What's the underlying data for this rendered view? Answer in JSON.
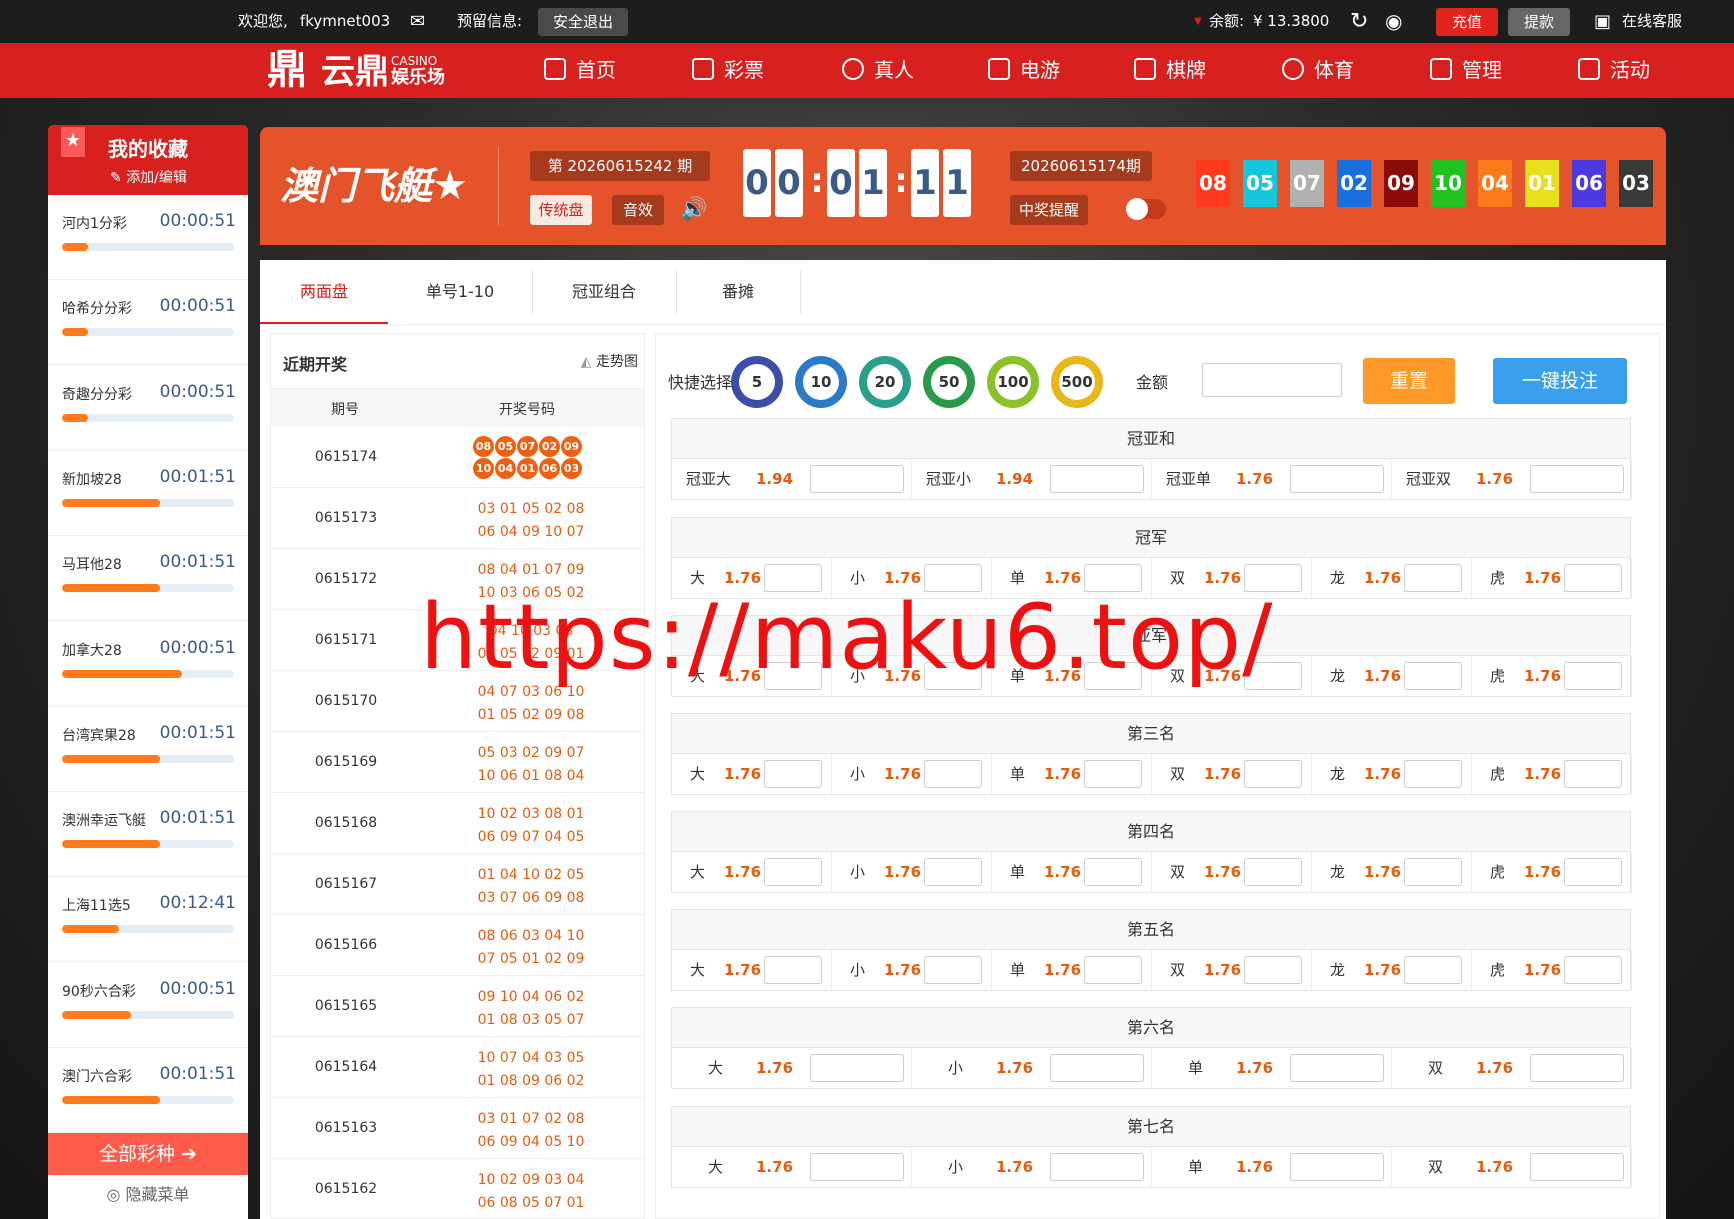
{
  "topbar": {
    "welcome": "欢迎您,",
    "username": "fkymnet003",
    "reserved": "预留信息:",
    "logout": "安全退出",
    "balance_label": "余额:",
    "balance_value": "¥ 13.3800",
    "recharge": "充值",
    "withdraw": "提款",
    "service": "在线客服"
  },
  "logo": {
    "mark": "鼎",
    "name": "云鼎",
    "casino": "CASINO",
    "sub": "娱乐场"
  },
  "nav": [
    "首页",
    "彩票",
    "真人",
    "电游",
    "棋牌",
    "体育",
    "管理",
    "活动"
  ],
  "sidebar": {
    "title": "我的收藏",
    "edit": "添加/编辑",
    "items": [
      {
        "name": "河内1分彩",
        "time": "00:00:51",
        "progress": 0.15
      },
      {
        "name": "哈希分分彩",
        "time": "00:00:51",
        "progress": 0.15
      },
      {
        "name": "奇趣分分彩",
        "time": "00:00:51",
        "progress": 0.15
      },
      {
        "name": "新加坡28",
        "time": "00:01:51",
        "progress": 0.57
      },
      {
        "name": "马耳他28",
        "time": "00:01:51",
        "progress": 0.57
      },
      {
        "name": "加拿大28",
        "time": "00:00:51",
        "progress": 0.7
      },
      {
        "name": "台湾宾果28",
        "time": "00:01:51",
        "progress": 0.57
      },
      {
        "name": "澳洲幸运飞艇",
        "time": "00:01:51",
        "progress": 0.57
      },
      {
        "name": "上海11选5",
        "time": "00:12:41",
        "progress": 0.33
      },
      {
        "name": "90秒六合彩",
        "time": "00:00:51",
        "progress": 0.4
      },
      {
        "name": "澳门六合彩",
        "time": "00:01:51",
        "progress": 0.57
      }
    ],
    "all_games": "全部彩种",
    "hide_menu": "隐藏菜单"
  },
  "game": {
    "title": "澳门飞艇",
    "issue": "第 20260615242 期",
    "traditional": "传统盘",
    "sound": "音效",
    "countdown": [
      "0",
      "0",
      ":",
      "0",
      "1",
      ":",
      "1",
      "1"
    ],
    "last_issue": "20260615174期",
    "win_alert": "中奖提醒",
    "balls": [
      {
        "n": "08",
        "c": "#ff3b1f"
      },
      {
        "n": "05",
        "c": "#15c6dd"
      },
      {
        "n": "07",
        "c": "#b0b0b0"
      },
      {
        "n": "02",
        "c": "#1a6fe0"
      },
      {
        "n": "09",
        "c": "#8b0a0a"
      },
      {
        "n": "10",
        "c": "#22c222"
      },
      {
        "n": "04",
        "c": "#ff7a1a"
      },
      {
        "n": "01",
        "c": "#e8e01a"
      },
      {
        "n": "06",
        "c": "#4a3ae0"
      },
      {
        "n": "03",
        "c": "#3a3a3a"
      }
    ]
  },
  "tabs": [
    "两面盘",
    "单号1-10",
    "冠亚组合",
    "番摊"
  ],
  "recent": {
    "title": "近期开奖",
    "trend": "走势图",
    "col_issue": "期号",
    "col_nums": "开奖号码",
    "first": {
      "issue": "0615174",
      "balls": [
        "08",
        "05",
        "07",
        "02",
        "09",
        "10",
        "04",
        "01",
        "06",
        "03"
      ]
    },
    "rows": [
      {
        "issue": "0615173",
        "a": "03 01 05 02 08",
        "b": "06 04 09 10 07"
      },
      {
        "issue": "0615172",
        "a": "08 04 01 07 09",
        "b": "10 03 06 05 02"
      },
      {
        "issue": "0615171",
        "a": "04 10 03 08",
        "b": "07 05 02 09 01"
      },
      {
        "issue": "0615170",
        "a": "04 07 03 06 10",
        "b": "01 05 02 09 08"
      },
      {
        "issue": "0615169",
        "a": "05 03 02 09 07",
        "b": "10 06 01 08 04"
      },
      {
        "issue": "0615168",
        "a": "10 02 03 08 01",
        "b": "06 09 07 04 05"
      },
      {
        "issue": "0615167",
        "a": "01 04 10 02 05",
        "b": "03 07 06 09 08"
      },
      {
        "issue": "0615166",
        "a": "08 06 03 04 10",
        "b": "07 05 01 02 09"
      },
      {
        "issue": "0615165",
        "a": "09 10 04 06 02",
        "b": "01 08 03 05 07"
      },
      {
        "issue": "0615164",
        "a": "10 07 04 03 05",
        "b": "01 08 09 06 02"
      },
      {
        "issue": "0615163",
        "a": "03 01 07 02 08",
        "b": "06 09 04 05 10"
      },
      {
        "issue": "0615162",
        "a": "10 02 09 03 04",
        "b": "06 08 05 07 01"
      }
    ]
  },
  "betting": {
    "quick": "快捷选择",
    "chips": [
      "5",
      "10",
      "20",
      "50",
      "100",
      "500"
    ],
    "amount": "金额",
    "reset": "重置",
    "bet": "一键投注",
    "sections": [
      {
        "title": "冠亚和",
        "cells": [
          [
            "冠亚大",
            "1.94"
          ],
          [
            "冠亚小",
            "1.94"
          ],
          [
            "冠亚单",
            "1.76"
          ],
          [
            "冠亚双",
            "1.76"
          ]
        ]
      },
      {
        "title": "冠军",
        "cells": [
          [
            "大",
            "1.76"
          ],
          [
            "小",
            "1.76"
          ],
          [
            "单",
            "1.76"
          ],
          [
            "双",
            "1.76"
          ],
          [
            "龙",
            "1.76"
          ],
          [
            "虎",
            "1.76"
          ]
        ]
      },
      {
        "title": "亚军",
        "cells": [
          [
            "大",
            "1.76"
          ],
          [
            "小",
            "1.76"
          ],
          [
            "单",
            "1.76"
          ],
          [
            "双",
            "1.76"
          ],
          [
            "龙",
            "1.76"
          ],
          [
            "虎",
            "1.76"
          ]
        ]
      },
      {
        "title": "第三名",
        "cells": [
          [
            "大",
            "1.76"
          ],
          [
            "小",
            "1.76"
          ],
          [
            "单",
            "1.76"
          ],
          [
            "双",
            "1.76"
          ],
          [
            "龙",
            "1.76"
          ],
          [
            "虎",
            "1.76"
          ]
        ]
      },
      {
        "title": "第四名",
        "cells": [
          [
            "大",
            "1.76"
          ],
          [
            "小",
            "1.76"
          ],
          [
            "单",
            "1.76"
          ],
          [
            "双",
            "1.76"
          ],
          [
            "龙",
            "1.76"
          ],
          [
            "虎",
            "1.76"
          ]
        ]
      },
      {
        "title": "第五名",
        "cells": [
          [
            "大",
            "1.76"
          ],
          [
            "小",
            "1.76"
          ],
          [
            "单",
            "1.76"
          ],
          [
            "双",
            "1.76"
          ],
          [
            "龙",
            "1.76"
          ],
          [
            "虎",
            "1.76"
          ]
        ]
      },
      {
        "title": "第六名",
        "cells": [
          [
            "大",
            "1.76"
          ],
          [
            "小",
            "1.76"
          ],
          [
            "单",
            "1.76"
          ],
          [
            "双",
            "1.76"
          ]
        ]
      },
      {
        "title": "第七名",
        "cells": [
          [
            "大",
            "1.76"
          ],
          [
            "小",
            "1.76"
          ],
          [
            "单",
            "1.76"
          ],
          [
            "双",
            "1.76"
          ]
        ]
      }
    ]
  },
  "watermark": "https://maku6.top/"
}
